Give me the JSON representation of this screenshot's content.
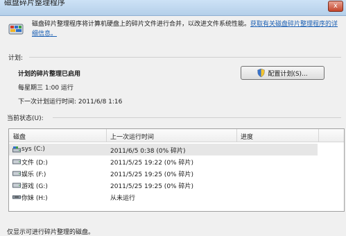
{
  "window": {
    "title": "磁盘碎片整理程序",
    "close_label": "x"
  },
  "description": {
    "text": "磁盘碎片整理程序将计算机硬盘上的碎片文件进行合并，以改进文件系统性能。",
    "link": "获取有关磁盘碎片整理程序的详细信息。"
  },
  "schedule": {
    "section_label": "计划:",
    "status": "计划的碎片整理已启用",
    "when": "每星期三  1:00 运行",
    "next_run": "下一次计划运行时间: 2011/6/8 1:16",
    "configure_button": "配置计划(S)..."
  },
  "current_status": {
    "section_label": "当前状态(U):"
  },
  "table": {
    "headers": [
      "磁盘",
      "上一次运行时间",
      "进度"
    ],
    "rows": [
      {
        "disk": "sys (C:)",
        "last_run": "2011/6/5 0:38 (0% 碎片)",
        "progress": "",
        "icon": "system-drive-icon"
      },
      {
        "disk": "文件 (D:)",
        "last_run": "2011/5/25 19:22 (0% 碎片)",
        "progress": "",
        "icon": "hard-drive-icon"
      },
      {
        "disk": "娱乐 (F:)",
        "last_run": "2011/5/25 19:25 (0% 碎片)",
        "progress": "",
        "icon": "hard-drive-icon"
      },
      {
        "disk": "游戏 (G:)",
        "last_run": "2011/5/25 19:25 (0% 碎片)",
        "progress": "",
        "icon": "hard-drive-icon"
      },
      {
        "disk": "你妹 (H:)",
        "last_run": "从未运行",
        "progress": "",
        "icon": "removable-drive-icon"
      }
    ]
  },
  "footer": {
    "text": "仅显示可进行碎片整理的磁盘。"
  },
  "colors": {
    "link": "#1a5fb4",
    "selected_row": "#e6e6e6",
    "titlebar": "#c0d8ef"
  }
}
